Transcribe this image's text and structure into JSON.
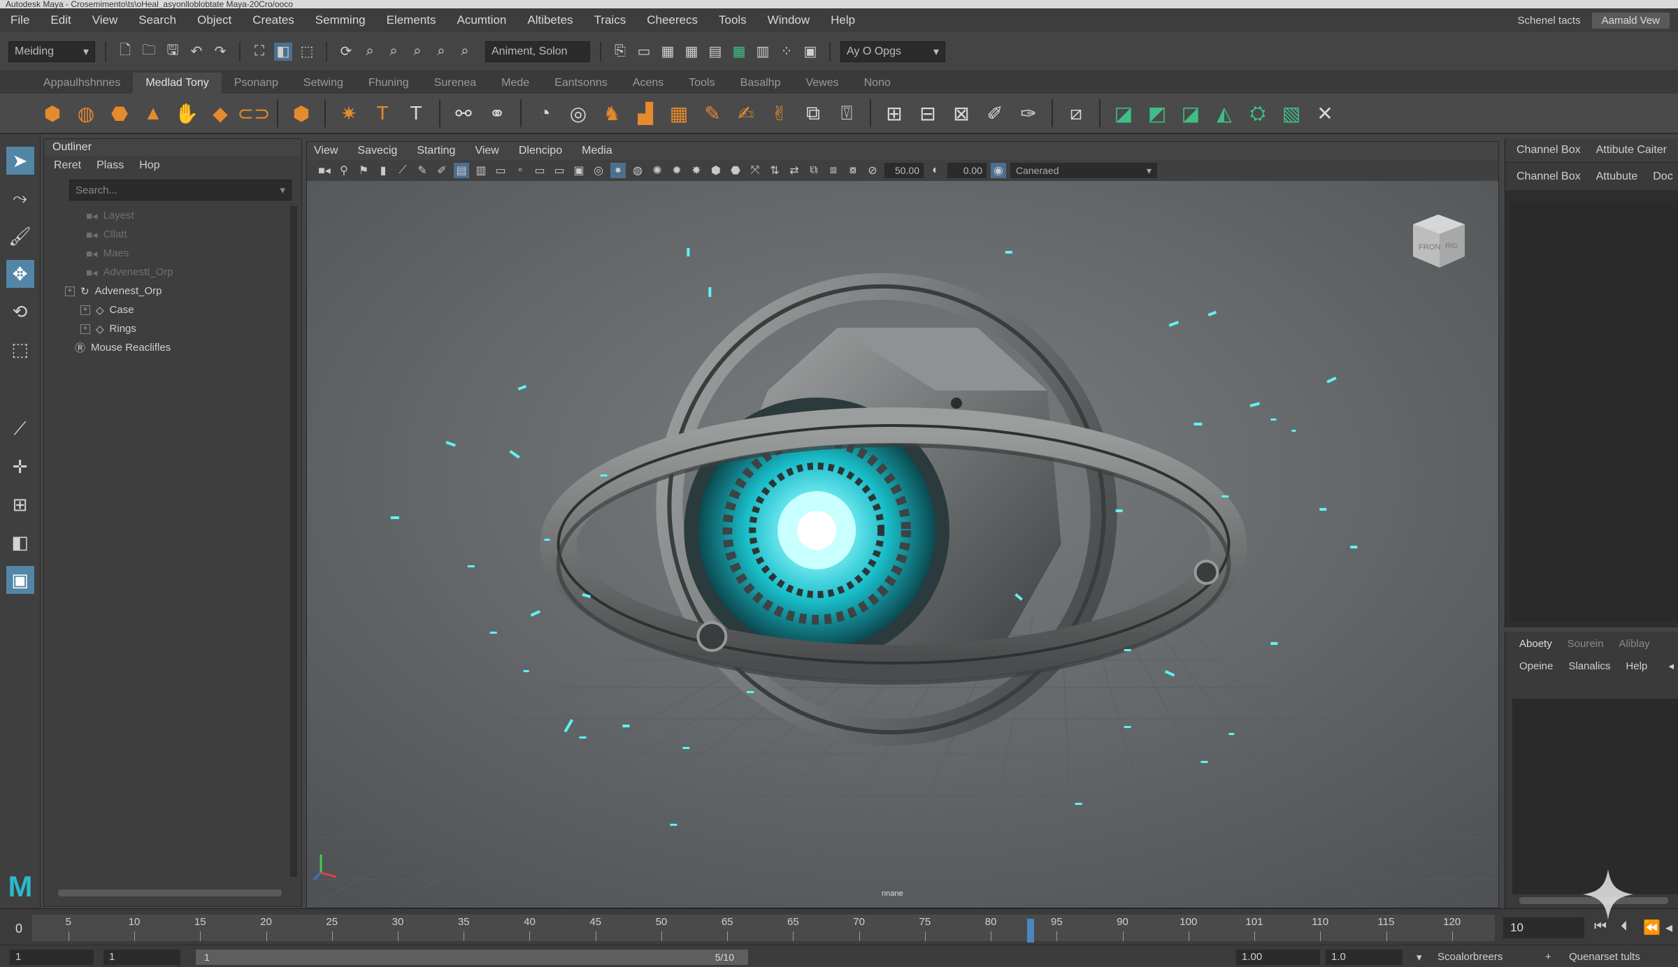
{
  "window": {
    "title": "Autodesk Maya - Crosemimento\\ts\\oHeal_asyonlloblobtate Maya-20Cro/ooco"
  },
  "menubar": {
    "items": [
      "File",
      "Edit",
      "View",
      "Search",
      "Object",
      "Creates",
      "Semming",
      "Elements",
      "Acumtion",
      "Altibetes",
      "Traics",
      "Cheerecs",
      "Tools",
      "Window",
      "Help"
    ],
    "right_label": "Schenel tacts",
    "workspace": "Aamald Vew"
  },
  "statusline": {
    "mode": "Meiding",
    "field": "Animent, Solon",
    "objects": "Ay O Opgs"
  },
  "shelf": {
    "tabs": [
      "Appaulhshnnes",
      "Medlad Tony",
      "Psonanp",
      "Setwing",
      "Fhuning",
      "Surenea",
      "Mede",
      "Eantsonns",
      "Acens",
      "Tools",
      "Basalhp",
      "Vewes",
      "Nono"
    ],
    "active_tab": "Medlad Tony"
  },
  "outliner": {
    "title": "Outliner",
    "menu": [
      "Reret",
      "Plass",
      "Hop"
    ],
    "search_placeholder": "Search...",
    "items": [
      {
        "label": "Layest",
        "dim": true
      },
      {
        "label": "Cllatt",
        "dim": true
      },
      {
        "label": "Maes",
        "dim": true
      },
      {
        "label": "Advenestt_Orp",
        "dim": true
      },
      {
        "label": "Advenest_Orp",
        "dim": false
      },
      {
        "label": "Case",
        "dim": false
      },
      {
        "label": "Rings",
        "dim": false
      },
      {
        "label": "Mouse Reaclifles",
        "dim": false
      }
    ]
  },
  "viewport": {
    "menu": [
      "View",
      "Savecig",
      "Starting",
      "View",
      "Dlencipo",
      "Media"
    ],
    "near": "50.00",
    "far": "0.00",
    "camera": "Caneraed",
    "bottom_label": "nnane",
    "viewcube_front": "FRON",
    "viewcube_right": "RIG"
  },
  "channelbox": {
    "tabs": [
      "Channel Box",
      "Attibute Caiter"
    ],
    "sub": [
      "Channel Box",
      "Attubute",
      "Doc"
    ]
  },
  "layereditor": {
    "tabs": [
      "Aboety",
      "Sourein",
      "Aliblay"
    ],
    "menu": [
      "Opeine",
      "Slanalics",
      "Help"
    ]
  },
  "timeslider": {
    "start": "0",
    "labels": [
      "5",
      "10",
      "15",
      "20",
      "25",
      "30",
      "35",
      "40",
      "45",
      "50",
      "65",
      "65",
      "70",
      "75",
      "80",
      "95",
      "90",
      "100",
      "101",
      "110",
      "115",
      "120"
    ],
    "current_frame": "10",
    "cursor_frame": 88
  },
  "rangeslider": {
    "start": "1",
    "start_inner": "1",
    "bar_start": "1",
    "bar_end": "5/10",
    "end": "1.00",
    "end_inner": "1.0",
    "anim_layer": "Scoalorbreers",
    "char_set": "Quenarset tults"
  }
}
